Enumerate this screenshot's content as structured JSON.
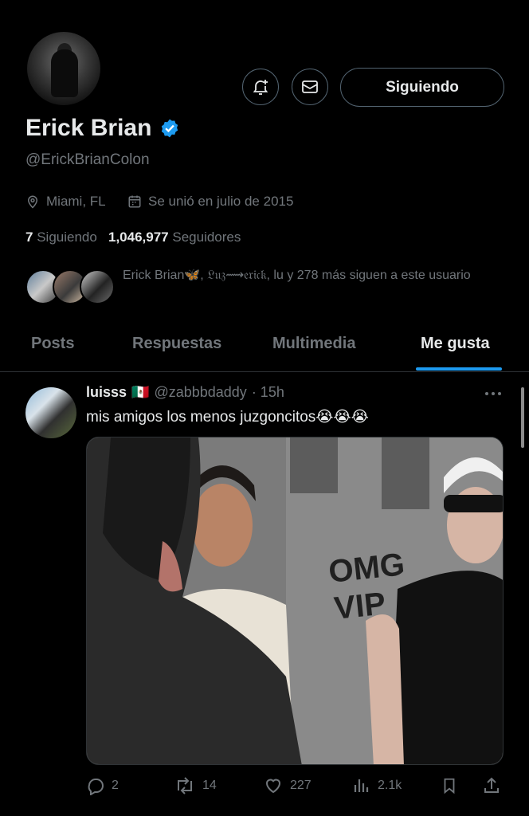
{
  "profile": {
    "name": "Erick Brian",
    "handle": "@ErickBrianColon",
    "location": "Miami, FL",
    "joined": "Se unió en julio de 2015",
    "following_count": "7",
    "following_label": "Siguiendo",
    "followers_count": "1,046,977",
    "followers_label": "Seguidores",
    "follow_button": "Siguiendo",
    "followed_by_text": "Erick Brian🦋, 𝔏𝔲𝔷⟿𝔢𝔯𝔦𝔠𝔨, lu y 278 más siguen a este usuario"
  },
  "tabs": [
    "Posts",
    "Respuestas",
    "Multimedia",
    "Me gusta"
  ],
  "active_tab": "Me gusta",
  "post": {
    "author": "luisss",
    "flag": "🇲🇽",
    "handle": "@zabbbdaddy",
    "time": "· 15h",
    "text": "mis amigos los menos juzgoncitos😭😭😭",
    "image_overlay_text_1": "OMG",
    "image_overlay_text_2": "VIP",
    "replies": "2",
    "reposts": "14",
    "likes": "227",
    "views": "2.1k"
  },
  "colors": {
    "background": "#000000",
    "accent": "#1d9bf0",
    "muted": "#71767b",
    "border": "#536471"
  },
  "icons": [
    "bell-plus-icon",
    "mail-icon",
    "verified-badge-icon",
    "location-icon",
    "calendar-icon",
    "more-icon",
    "reply-icon",
    "repost-icon",
    "like-icon",
    "views-icon",
    "bookmark-icon",
    "share-icon"
  ]
}
